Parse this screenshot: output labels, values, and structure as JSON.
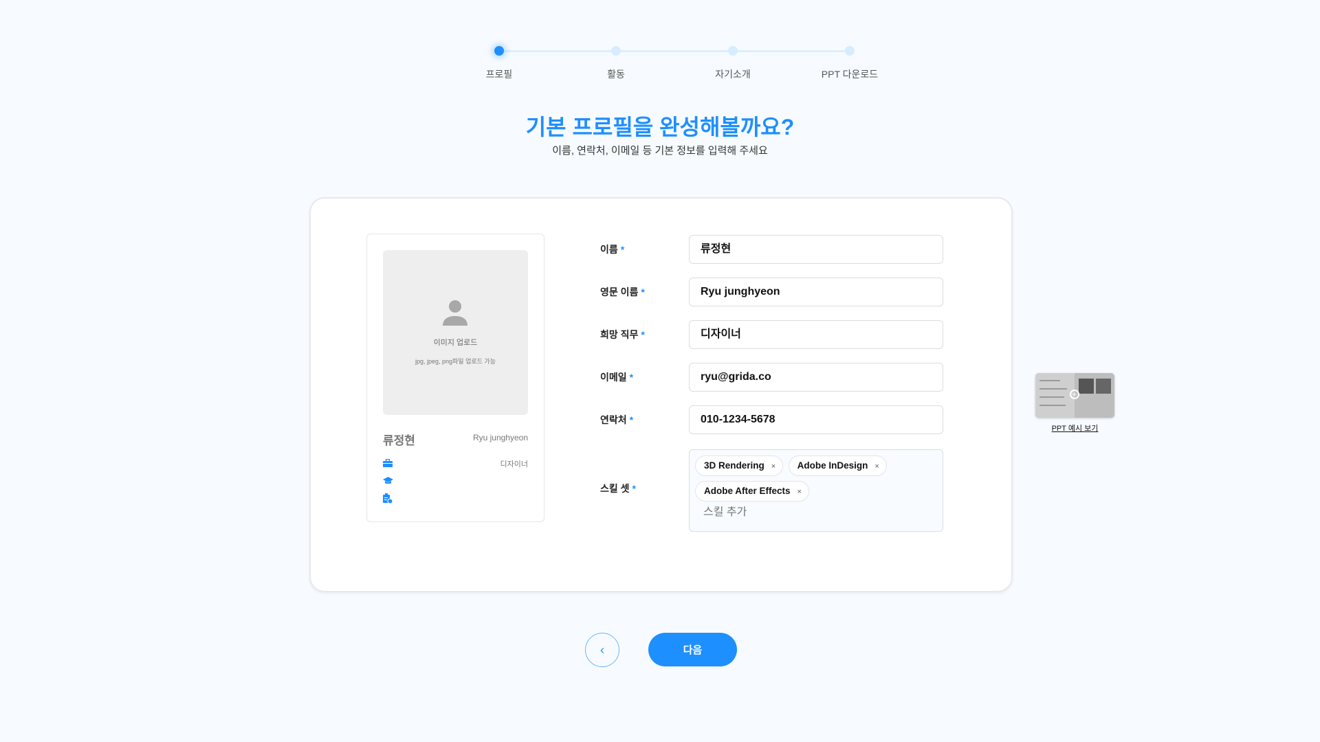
{
  "stepper": {
    "steps": [
      {
        "label": "프로필",
        "active": true
      },
      {
        "label": "활동",
        "active": false
      },
      {
        "label": "자기소개",
        "active": false
      },
      {
        "label": "PPT 다운로드",
        "active": false
      }
    ]
  },
  "header": {
    "title": "기본 프로필을 완성해볼까요?",
    "subtitle": "이름, 연락처, 이메일 등 기본 정보를 입력해 주세요"
  },
  "preview": {
    "upload_title": "이미지 업로드",
    "upload_hint": "jpg, jpeg, png파일 업로드 가능",
    "name": "류정현",
    "english_name": "Ryu junghyeon",
    "job": "디자이너"
  },
  "form": {
    "required_mark": "*",
    "fields": [
      {
        "label": "이름",
        "value": "류정현"
      },
      {
        "label": "영문 이름",
        "value": "Ryu junghyeon"
      },
      {
        "label": "희망 직무",
        "value": "디자이너"
      },
      {
        "label": "이메일",
        "value": "ryu@grida.co"
      },
      {
        "label": "연락처",
        "value": "010-1234-5678"
      }
    ],
    "skills": {
      "label": "스킬 셋",
      "chips": [
        "3D Rendering",
        "Adobe InDesign",
        "Adobe After Effects"
      ],
      "remove_glyph": "×",
      "placeholder": "스킬 추가"
    }
  },
  "ppt_example": {
    "label": "PPT 예시 보기"
  },
  "nav": {
    "back_glyph": "‹",
    "next_label": "다음"
  },
  "colors": {
    "accent": "#1e8fff",
    "background": "#f7fbff"
  }
}
